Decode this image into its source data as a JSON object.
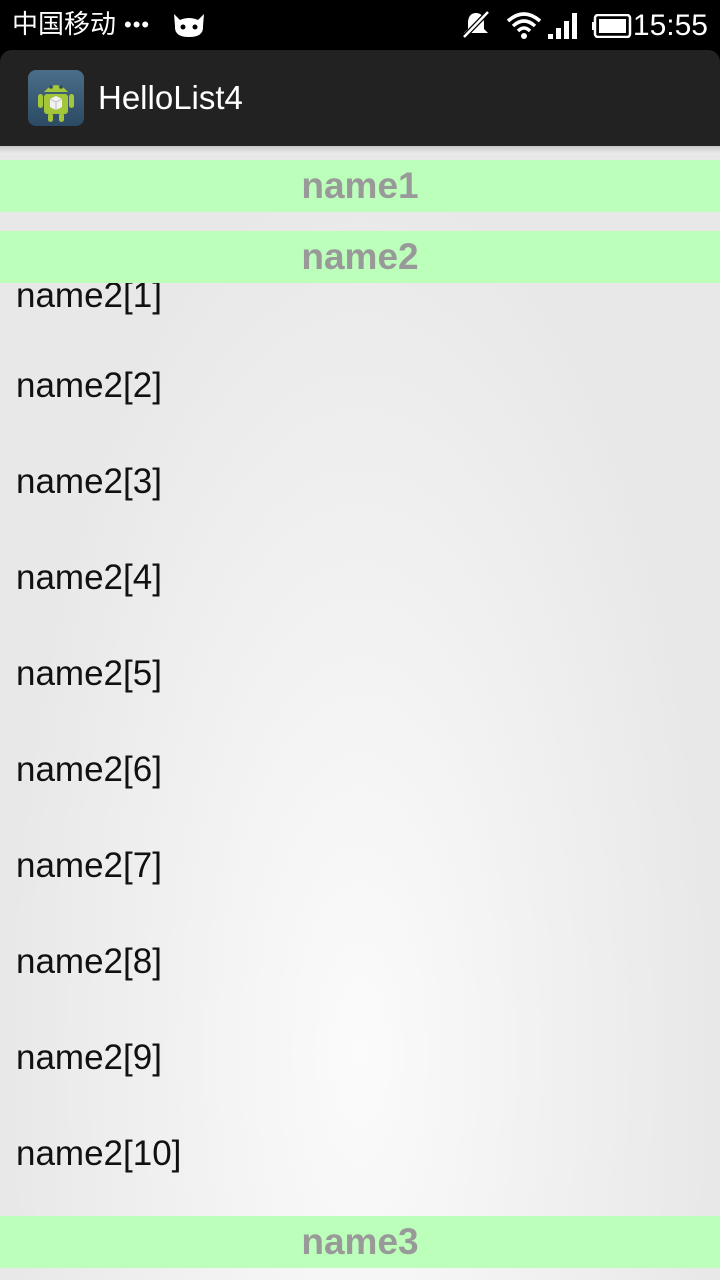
{
  "status_bar": {
    "carrier": "中国移动",
    "dots": "•••",
    "icons": [
      "cat-icon",
      "mute-icon",
      "wifi-icon",
      "signal-icon",
      "battery-icon"
    ],
    "time": "15:55"
  },
  "action_bar": {
    "app_icon": "android-app-icon",
    "title": "HelloList4"
  },
  "list": {
    "groups": [
      {
        "label": "name1"
      },
      {
        "label": "name2"
      },
      {
        "label": "name3"
      }
    ],
    "children": [
      "name2[1]",
      "name2[2]",
      "name2[3]",
      "name2[4]",
      "name2[5]",
      "name2[6]",
      "name2[7]",
      "name2[8]",
      "name2[9]",
      "name2[10]"
    ]
  },
  "colors": {
    "header_bg": "#bbffbb",
    "header_text": "#999999",
    "action_bar_bg": "#222222"
  }
}
